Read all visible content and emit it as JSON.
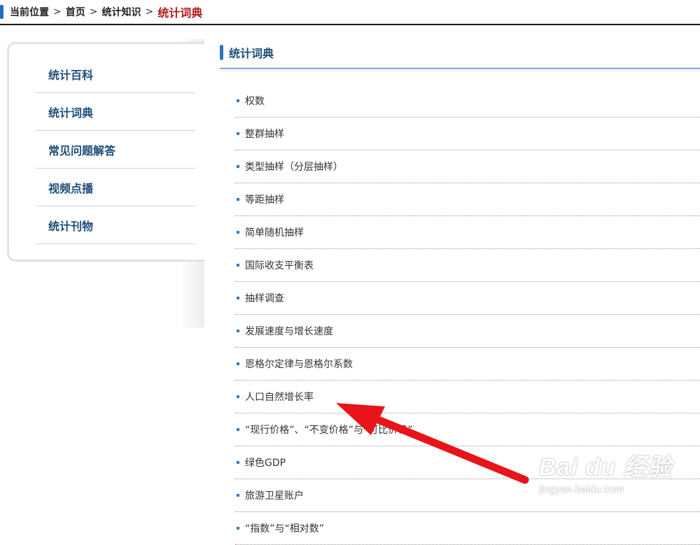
{
  "breadcrumb": {
    "items": [
      "当前位置",
      "首页",
      "统计知识"
    ],
    "current": "统计词典",
    "separator": ">"
  },
  "sidebar": {
    "items": [
      {
        "label": "统计百科"
      },
      {
        "label": "统计词典"
      },
      {
        "label": "常见问题解答"
      },
      {
        "label": "视频点播"
      },
      {
        "label": "统计刊物"
      }
    ]
  },
  "main": {
    "title": "统计词典",
    "terms": [
      "权数",
      "整群抽样",
      "类型抽样（分层抽样）",
      "等距抽样",
      "简单随机抽样",
      "国际收支平衡表",
      "抽样调查",
      "发展速度与增长速度",
      "恩格尔定律与恩格尔系数",
      "人口自然增长率",
      "“现行价格”、“不变价格”与“可比价格”",
      "绿色GDP",
      "旅游卫星账户",
      "“指数”与“相对数”"
    ]
  },
  "watermark": {
    "logo": "Bai du 经验",
    "url": "jingyan.baidu.com"
  },
  "colors": {
    "accent_blue": "#2e73bb",
    "breadcrumb_current": "#b01818",
    "annotation_arrow": "#e8141a"
  }
}
